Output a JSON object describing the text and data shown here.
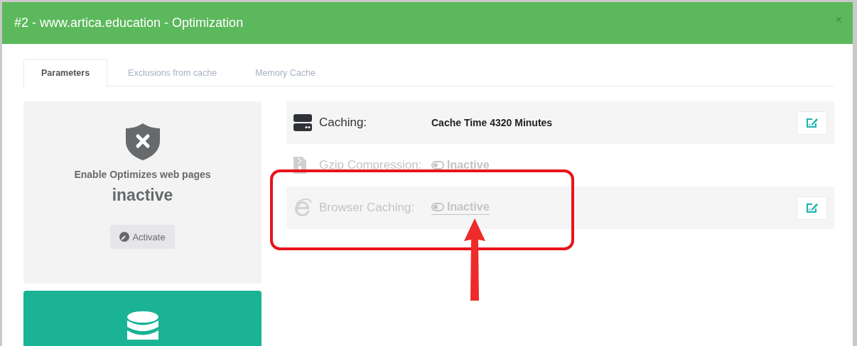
{
  "window": {
    "title": "#2 - www.artica.education - Optimization",
    "close": "×"
  },
  "tabs": [
    {
      "label": "Parameters",
      "selected": true
    },
    {
      "label": "Exclusions from cache",
      "selected": false
    },
    {
      "label": "Memory Cache",
      "selected": false
    }
  ],
  "status_card": {
    "title": "Enable Optimizes web pages",
    "status": "inactive",
    "button": "Activate"
  },
  "settings": [
    {
      "kind": "value",
      "label": "Caching:",
      "value": "Cache Time 4320 Minutes",
      "disabled": false,
      "editable": true
    },
    {
      "kind": "toggle",
      "label": "Gzip Compression:",
      "value": "Inactive",
      "on": false,
      "disabled": true,
      "editable": false,
      "link": false
    },
    {
      "kind": "toggle",
      "label": "Browser Caching:",
      "value": "Inactive",
      "on": false,
      "disabled": true,
      "editable": true,
      "link": true
    }
  ]
}
